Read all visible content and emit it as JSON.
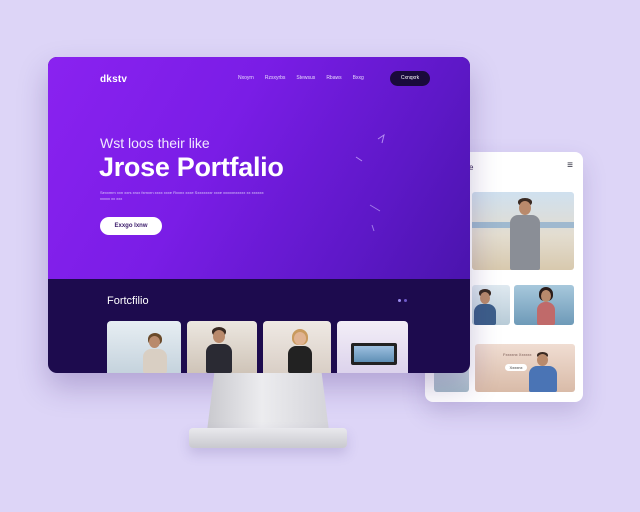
{
  "hero": {
    "brand": "dkstv",
    "nav_links": [
      "Nxoyrn",
      "Rzsxyrbs",
      "Stewsus",
      "Rbaws",
      "Bxxg"
    ],
    "nav_cta": "Cxnqxrk",
    "kicker": "Wst loos their like",
    "title": "Jrose Portfalio",
    "description": "Sexxmrn xxn xxrs xrox fxrnxrn xxxx xxxe Rxxnx xxxe Sxxxxxxxr xxxe xxxxxnxxxxx xx xxxxxx xxxxx xx xxx",
    "button": "Exxgo Ixnw"
  },
  "portfolio": {
    "title": "Fortcfilio"
  },
  "phone": {
    "label": "e",
    "menu_icon": "≡",
    "card_title": "Fxxxxnx Xxxxxx",
    "card_button": "Xxxxnx"
  },
  "colors": {
    "background": "#ddd5f7",
    "hero_start": "#8a22f0",
    "hero_end": "#4a14ad",
    "section_dark": "#1d0b4e",
    "cta_dark": "#1a0a3c"
  }
}
